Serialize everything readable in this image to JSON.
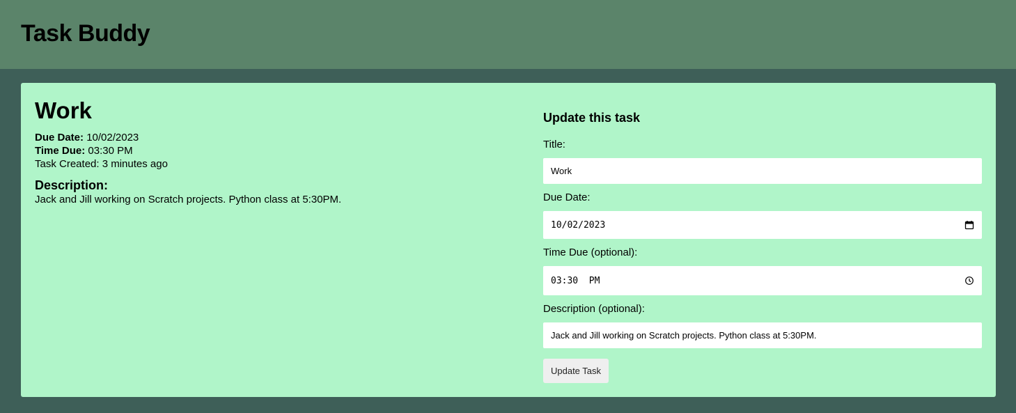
{
  "header": {
    "app_title": "Task Buddy"
  },
  "task": {
    "title": "Work",
    "due_date_label": "Due Date:",
    "due_date": "10/02/2023",
    "time_due_label": "Time Due:",
    "time_due": "03:30 PM",
    "created_text": "Task Created: 3 minutes ago",
    "description_heading": "Description:",
    "description": "Jack and Jill working on Scratch projects. Python class at 5:30PM."
  },
  "form": {
    "heading": "Update this task",
    "title_label": "Title:",
    "title_value": "Work",
    "due_date_label": "Due Date:",
    "due_date_value": "10/02/2023",
    "time_label": "Time Due (optional):",
    "time_value": "03:30  PM",
    "description_label": "Description (optional):",
    "description_value": "Jack and Jill working on Scratch projects. Python class at 5:30PM.",
    "submit_label": "Update Task",
    "calendar_icon": "calendar-icon",
    "clock_icon": "clock-icon"
  },
  "colors": {
    "header_bg": "#5b846a",
    "page_bg": "#3e5f58",
    "card_bg": "#b0f5c9"
  }
}
